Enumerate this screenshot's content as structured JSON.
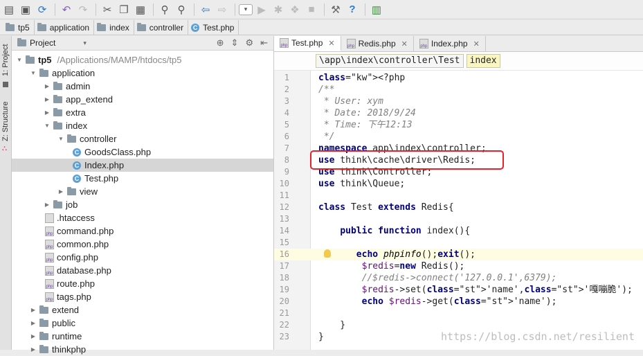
{
  "toolbar": {
    "icons": [
      "folder-open",
      "save",
      "sync",
      "separator",
      "undo",
      "redo",
      "separator",
      "cut",
      "copy",
      "paste",
      "separator",
      "find",
      "replace",
      "separator",
      "back",
      "forward",
      "separator",
      "run-config",
      "run",
      "debug",
      "coverage",
      "stop",
      "separator",
      "settings",
      "help",
      "separator",
      "sdk"
    ]
  },
  "breadcrumb": {
    "items": [
      {
        "label": "tp5",
        "icon": "folder"
      },
      {
        "label": "application",
        "icon": "folder"
      },
      {
        "label": "index",
        "icon": "folder"
      },
      {
        "label": "controller",
        "icon": "folder"
      },
      {
        "label": "Test.php",
        "icon": "class"
      }
    ]
  },
  "side_strip": {
    "project": "1: Project",
    "structure": "Z: Structure"
  },
  "project_panel": {
    "header": "Project",
    "root": {
      "label": "tp5",
      "path": "/Applications/MAMP/htdocs/tp5"
    },
    "rows": [
      {
        "label": "application",
        "depth": 1,
        "type": "folder",
        "open": true
      },
      {
        "label": "admin",
        "depth": 2,
        "type": "folder",
        "open": false
      },
      {
        "label": "app_extend",
        "depth": 2,
        "type": "folder",
        "open": false
      },
      {
        "label": "extra",
        "depth": 2,
        "type": "folder",
        "open": false
      },
      {
        "label": "index",
        "depth": 2,
        "type": "folder",
        "open": true
      },
      {
        "label": "controller",
        "depth": 3,
        "type": "folder",
        "open": true
      },
      {
        "label": "GoodsClass.php",
        "depth": 4,
        "type": "class"
      },
      {
        "label": "Index.php",
        "depth": 4,
        "type": "class",
        "selected": true
      },
      {
        "label": "Test.php",
        "depth": 4,
        "type": "class"
      },
      {
        "label": "view",
        "depth": 3,
        "type": "folder",
        "open": false
      },
      {
        "label": "job",
        "depth": 2,
        "type": "folder",
        "open": false
      },
      {
        "label": ".htaccess",
        "depth": 2,
        "type": "file"
      },
      {
        "label": "command.php",
        "depth": 2,
        "type": "php"
      },
      {
        "label": "common.php",
        "depth": 2,
        "type": "php"
      },
      {
        "label": "config.php",
        "depth": 2,
        "type": "php"
      },
      {
        "label": "database.php",
        "depth": 2,
        "type": "php"
      },
      {
        "label": "route.php",
        "depth": 2,
        "type": "php"
      },
      {
        "label": "tags.php",
        "depth": 2,
        "type": "php"
      },
      {
        "label": "extend",
        "depth": 1,
        "type": "folder",
        "open": false
      },
      {
        "label": "public",
        "depth": 1,
        "type": "folder",
        "open": false
      },
      {
        "label": "runtime",
        "depth": 1,
        "type": "folder",
        "open": false
      },
      {
        "label": "thinkphp",
        "depth": 1,
        "type": "folder",
        "open": false
      }
    ]
  },
  "editor": {
    "tabs": [
      {
        "label": "Test.php",
        "active": true
      },
      {
        "label": "Redis.php",
        "active": false
      },
      {
        "label": "Index.php",
        "active": false
      }
    ],
    "crumbs": [
      "\\app\\index\\controller\\Test",
      "index"
    ],
    "lines": [
      {
        "n": "1",
        "t": "<?php"
      },
      {
        "n": "2",
        "t": "/**"
      },
      {
        "n": "3",
        "t": " * User: xym"
      },
      {
        "n": "4",
        "t": " * Date: 2018/9/24"
      },
      {
        "n": "5",
        "t": " * Time: 下午12:13"
      },
      {
        "n": "6",
        "t": " */"
      },
      {
        "n": "7",
        "t": "namespace app\\index\\controller;"
      },
      {
        "n": "8",
        "t": "use think\\cache\\driver\\Redis;"
      },
      {
        "n": "9",
        "t": "use think\\Controller;"
      },
      {
        "n": "10",
        "t": "use think\\Queue;"
      },
      {
        "n": "11",
        "t": ""
      },
      {
        "n": "12",
        "t": "class Test extends Redis{"
      },
      {
        "n": "13",
        "t": ""
      },
      {
        "n": "14",
        "t": "    public function index(){"
      },
      {
        "n": "15",
        "t": ""
      },
      {
        "n": "16",
        "t": "       echo phpinfo();exit();"
      },
      {
        "n": "17",
        "t": "        $redis=new Redis();"
      },
      {
        "n": "18",
        "t": "        //$redis->connect('127.0.0.1',6379);"
      },
      {
        "n": "19",
        "t": "        $redis->set('name','嘎嘣脆');"
      },
      {
        "n": "20",
        "t": "        echo $redis->get('name');"
      },
      {
        "n": "21",
        "t": ""
      },
      {
        "n": "22",
        "t": "    }"
      },
      {
        "n": "23",
        "t": "}"
      }
    ]
  },
  "watermark": "https://blog.csdn.net/resilient"
}
